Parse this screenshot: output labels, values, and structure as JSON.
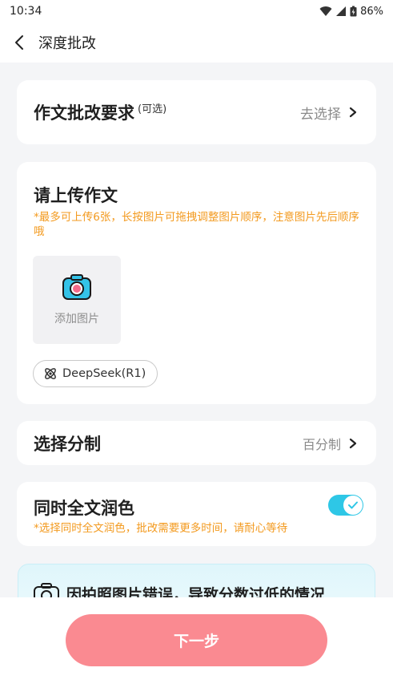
{
  "status_bar": {
    "time": "10:34",
    "battery": "86%"
  },
  "nav": {
    "title": "深度批改"
  },
  "requirements": {
    "title": "作文批改要求",
    "optional_tag": "(可选)",
    "action": "去选择"
  },
  "upload": {
    "title": "请上传作文",
    "hint": "*最多可上传6张，长按图片可拖拽调整图片顺序，注意图片先后顺序哦",
    "add_label": "添加图片",
    "model_label": "DeepSeek(R1)"
  },
  "grading": {
    "title": "选择分制",
    "value": "百分制"
  },
  "polish": {
    "title": "同时全文润色",
    "hint": "*选择同时全文润色，批改需要更多时间，请耐心等待",
    "enabled": true
  },
  "banner": {
    "text": "因拍照图片错误，导致分数过低的情况"
  },
  "footer": {
    "next_label": "下一步"
  },
  "colors": {
    "accent": "#2ec7e6",
    "warning": "#f39a1f",
    "button": "#fa8a91"
  }
}
